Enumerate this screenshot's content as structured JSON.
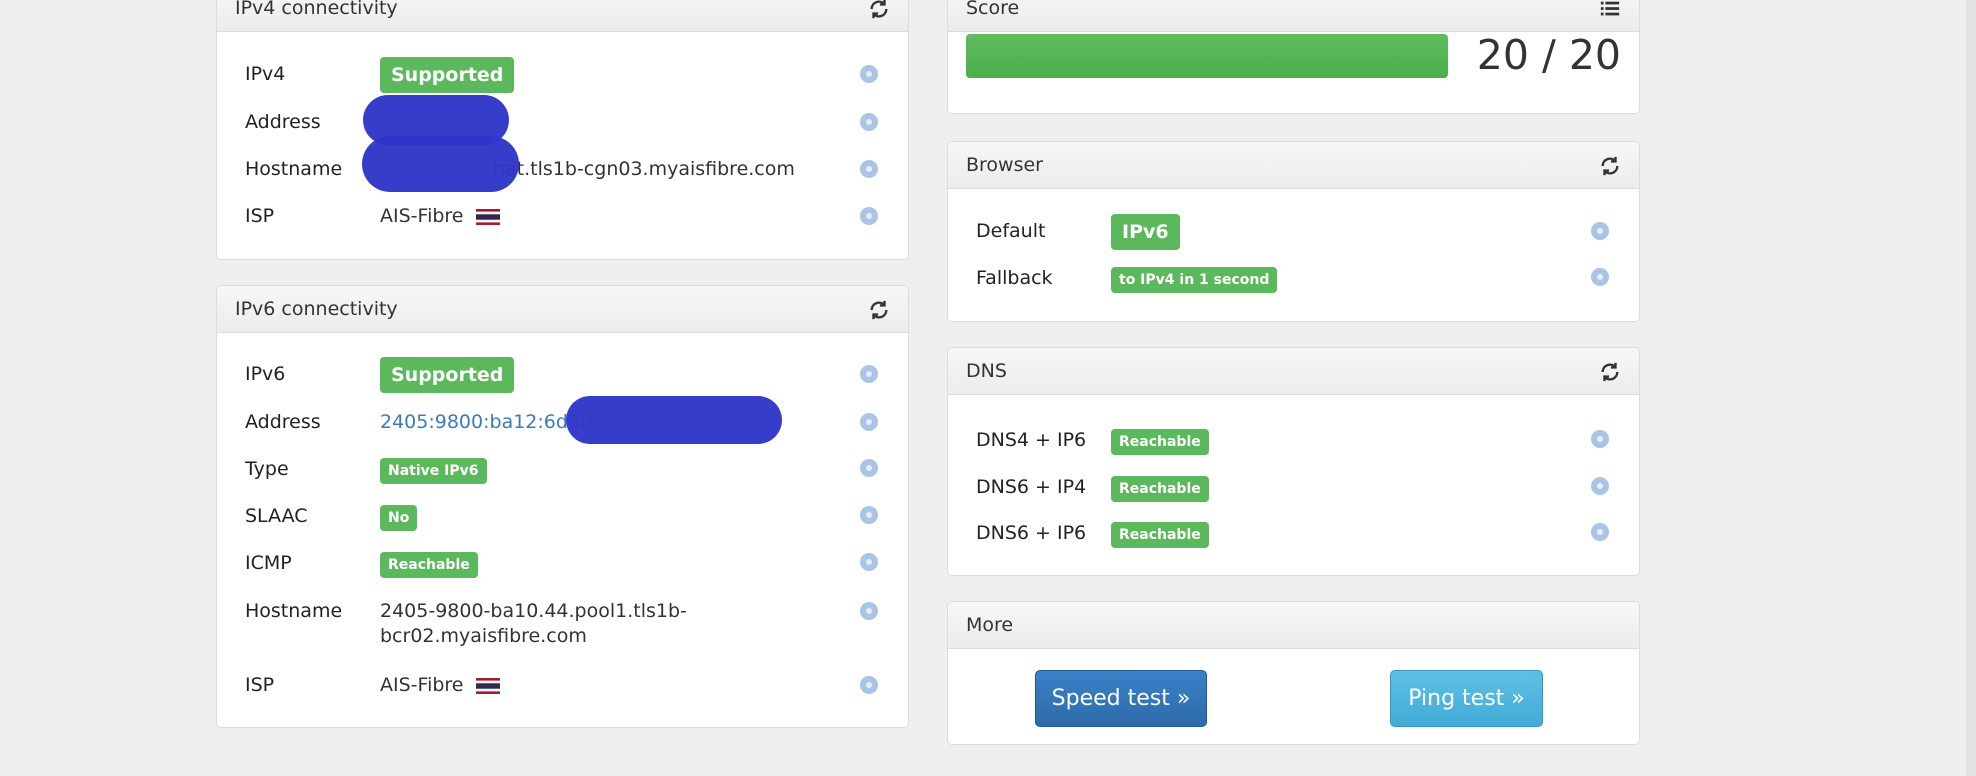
{
  "ipv4": {
    "title": "IPv4 connectivity",
    "rows": {
      "ipv4": {
        "label": "IPv4",
        "badge": "Supported"
      },
      "address": {
        "label": "Address",
        "value": ""
      },
      "hostname": {
        "label": "Hostname",
        "value": "nat.tls1b-cgn03.myaisfibre.com"
      },
      "isp": {
        "label": "ISP",
        "value": "AIS-Fibre",
        "flag": "thailand-flag"
      }
    }
  },
  "ipv6": {
    "title": "IPv6 connectivity",
    "rows": {
      "ipv6": {
        "label": "IPv6",
        "badge": "Supported"
      },
      "address": {
        "label": "Address",
        "value": "2405:9800:ba12:6d50"
      },
      "type": {
        "label": "Type",
        "badge": "Native IPv6"
      },
      "slaac": {
        "label": "SLAAC",
        "badge": "No"
      },
      "icmp": {
        "label": "ICMP",
        "badge": "Reachable"
      },
      "hostname": {
        "label": "Hostname",
        "value_line1": "2405-9800-ba10.44.pool1.tls1b-",
        "value_line2": "bcr02.myaisfibre.com"
      },
      "isp": {
        "label": "ISP",
        "value": "AIS-Fibre",
        "flag": "thailand-flag"
      }
    }
  },
  "score": {
    "title": "Score",
    "text": "20 / 20",
    "fraction": 1.0,
    "icon": "list-icon"
  },
  "browser": {
    "title": "Browser",
    "rows": {
      "default": {
        "label": "Default",
        "badge": "IPv6"
      },
      "fallback": {
        "label": "Fallback",
        "badge": "to IPv4 in 1 second"
      }
    }
  },
  "dns": {
    "title": "DNS",
    "rows": [
      {
        "label": "DNS4 + IP6",
        "badge": "Reachable"
      },
      {
        "label": "DNS6 + IP4",
        "badge": "Reachable"
      },
      {
        "label": "DNS6 + IP6",
        "badge": "Reachable"
      }
    ]
  },
  "more": {
    "title": "More",
    "speed_test": "Speed test »",
    "ping_test": "Ping test »"
  },
  "colors": {
    "success": "#5cb85c",
    "primary": "#2d6bab",
    "info": "#42abd6",
    "help": "#a9c4e6",
    "link": "#3d7ab8",
    "scribble": "#2f35c9"
  },
  "icons": {
    "refresh": "refresh-icon",
    "help": "help-icon",
    "list": "list-icon"
  }
}
